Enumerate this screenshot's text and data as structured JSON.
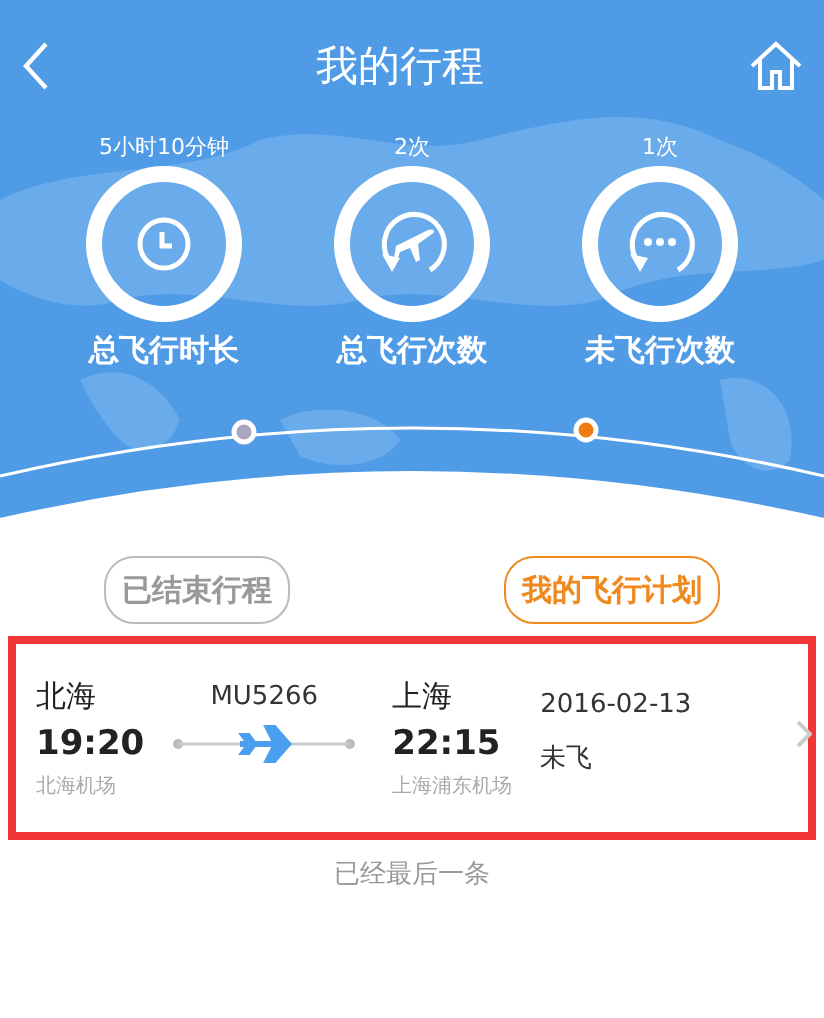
{
  "nav": {
    "title": "我的行程"
  },
  "stats": [
    {
      "kind": "duration",
      "value": "5小时10分钟",
      "label": "总飞行时长"
    },
    {
      "kind": "flown",
      "value": "2次",
      "label": "总飞行次数"
    },
    {
      "kind": "pending",
      "value": "1次",
      "label": "未飞行次数"
    }
  ],
  "tabs": [
    {
      "label": "已结束行程",
      "selected": false
    },
    {
      "label": "我的飞行计划",
      "selected": true
    }
  ],
  "flights": [
    {
      "highlighted": true,
      "from_city": "北海",
      "depart_time": "19:20",
      "from_airport": "北海机场",
      "flight_no": "MU5266",
      "to_city": "上海",
      "arrive_time": "22:15",
      "to_airport": "上海浦东机场",
      "date": "2016-02-13",
      "status": "未飞"
    }
  ],
  "footer": "已经最后一条"
}
